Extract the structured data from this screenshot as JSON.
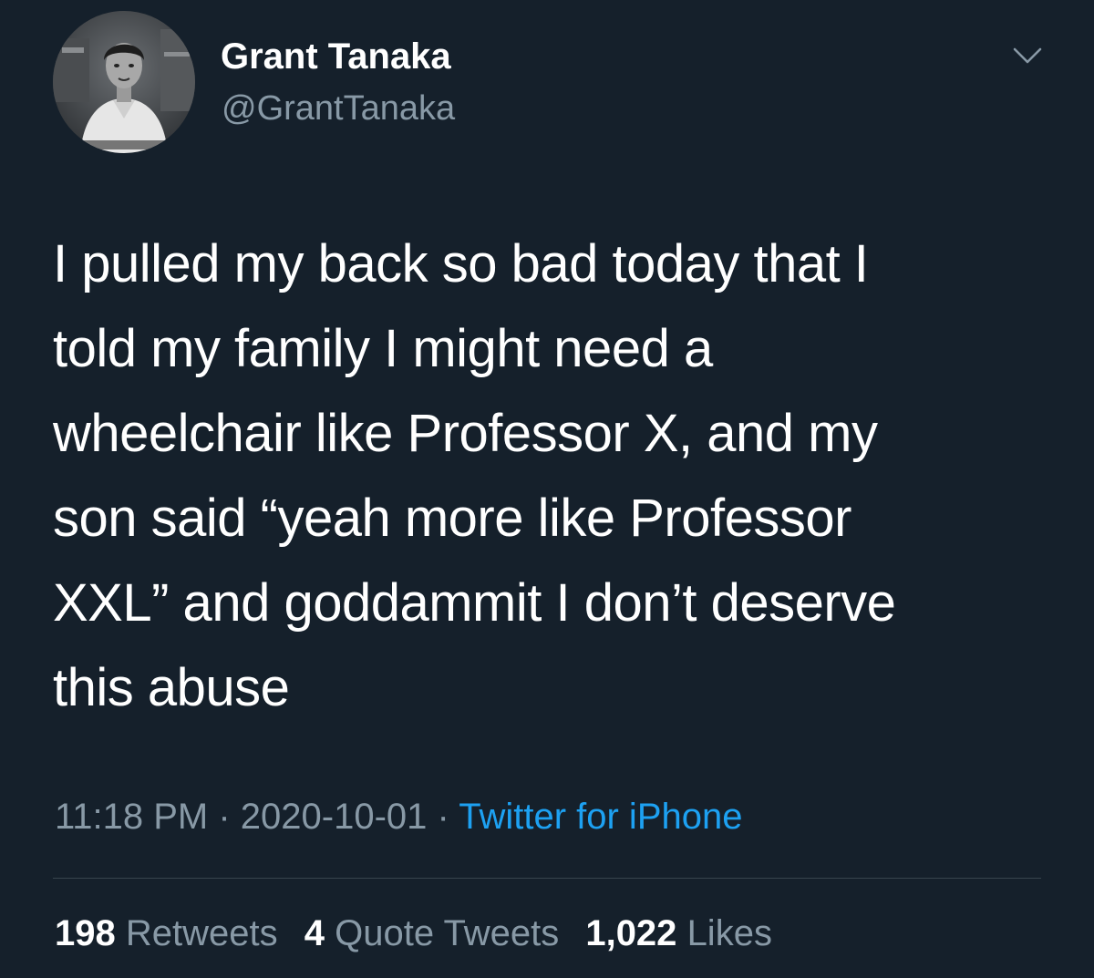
{
  "user": {
    "display_name": "Grant Tanaka",
    "handle": "@GrantTanaka",
    "avatar_icon": "profile-photo"
  },
  "tweet": {
    "lines": [
      "I pulled my back so bad today that I",
      "told my family I might need a",
      "wheelchair like Professor X, and my",
      "son said “yeah more like Professor",
      "XXL” and goddammit I don’t deserve",
      "this abuse"
    ]
  },
  "meta": {
    "time": "11:18 PM",
    "separator": " · ",
    "date": "2020-10-01",
    "source": "Twitter for iPhone"
  },
  "stats": {
    "retweets_count": "198",
    "retweets_label": "Retweets",
    "quotes_count": "4",
    "quotes_label": "Quote Tweets",
    "likes_count": "1,022",
    "likes_label": "Likes"
  },
  "colors": {
    "background": "#15202b",
    "primary_text": "#ffffff",
    "secondary_text": "#8899a6",
    "link": "#1da1f2",
    "divider": "#38444d"
  },
  "icons": {
    "more": "chevron-down-icon"
  }
}
